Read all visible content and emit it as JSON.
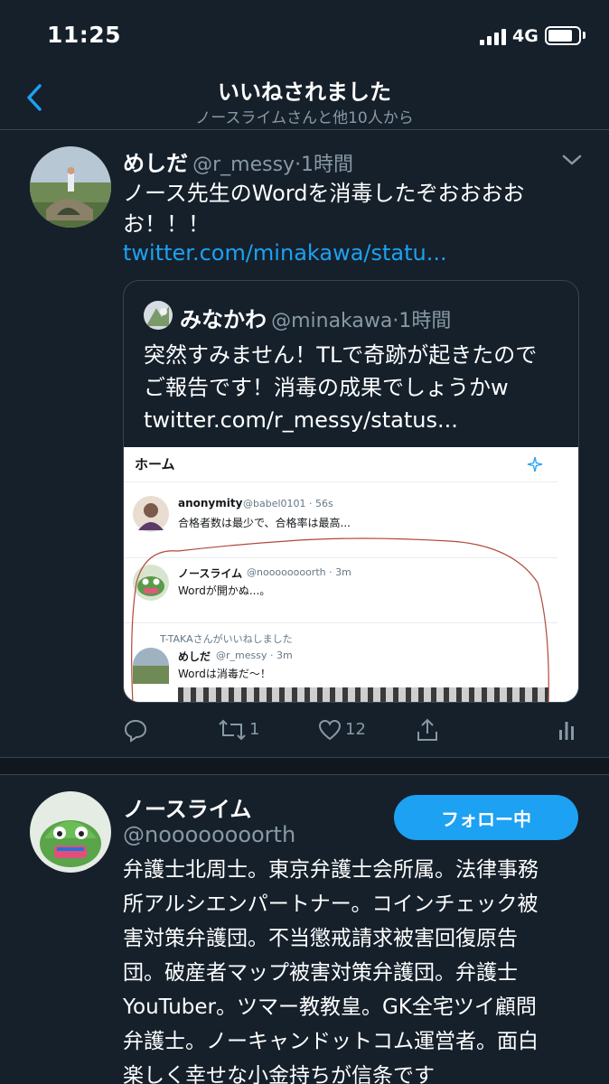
{
  "status_bar": {
    "time": "11:25",
    "network": "4G",
    "battery_level": 0.8
  },
  "header": {
    "title": "いいねされました",
    "subtitle": "ノースライムさんと他10人から"
  },
  "tweet": {
    "author_name": "めしだ",
    "author_handle": "@r_messy",
    "time": "·1時間",
    "text_line1": "ノース先生のWordを消毒したぞおおおお",
    "text_line2": "お！！！",
    "link": "twitter.com/minakawa/statu...",
    "quote": {
      "author_name": "みなかわ",
      "author_handle": "@minakawa",
      "time": "·1時間",
      "text_line1": "突然すみません！TLで奇跡が起きたので",
      "text_line2": "ご報告です！消毒の成果でしょうかw",
      "link": "twitter.com/r_messy/status...",
      "screenshot": {
        "header": "ホーム",
        "t1_name": "anonymity",
        "t1_handle": "@babel0101 · 56s",
        "t1_text": "合格者数は最少で、合格率は最高...",
        "t2_name": "ノースライム",
        "t2_handle": "@noooooooorth · 3m",
        "t2_text": "Wordが開かぬ...。",
        "t3_context": "T-TAKAさんがいいねしました",
        "t3_name": "めしだ",
        "t3_handle": "@r_messy · 3m",
        "t3_text": "Wordは消毒だ～！"
      }
    },
    "retweet_count": "1",
    "like_count": "12"
  },
  "profile": {
    "name": "ノースライム",
    "handle": "@noooooooorth",
    "follow_label": "フォロー中",
    "bio_lines": [
      "弁護士北周士。東京弁護士会所属。法律事務",
      "所アルシエンパートナー。コインチェック被",
      "害対策弁護団。不当懲戒請求被害回復原告",
      "団。破産者マップ被害対策弁護団。弁護士",
      "YouTuber。ツマー教教皇。GK全宅ツイ顧問",
      "弁護士。ノーキャンドットコム運営者。面白",
      "楽しく幸せな小金持ちが信条です"
    ]
  },
  "colors": {
    "background": "#15202b",
    "accent": "#1da1f2",
    "secondary_text": "#8899a6",
    "divider": "#38444d"
  }
}
